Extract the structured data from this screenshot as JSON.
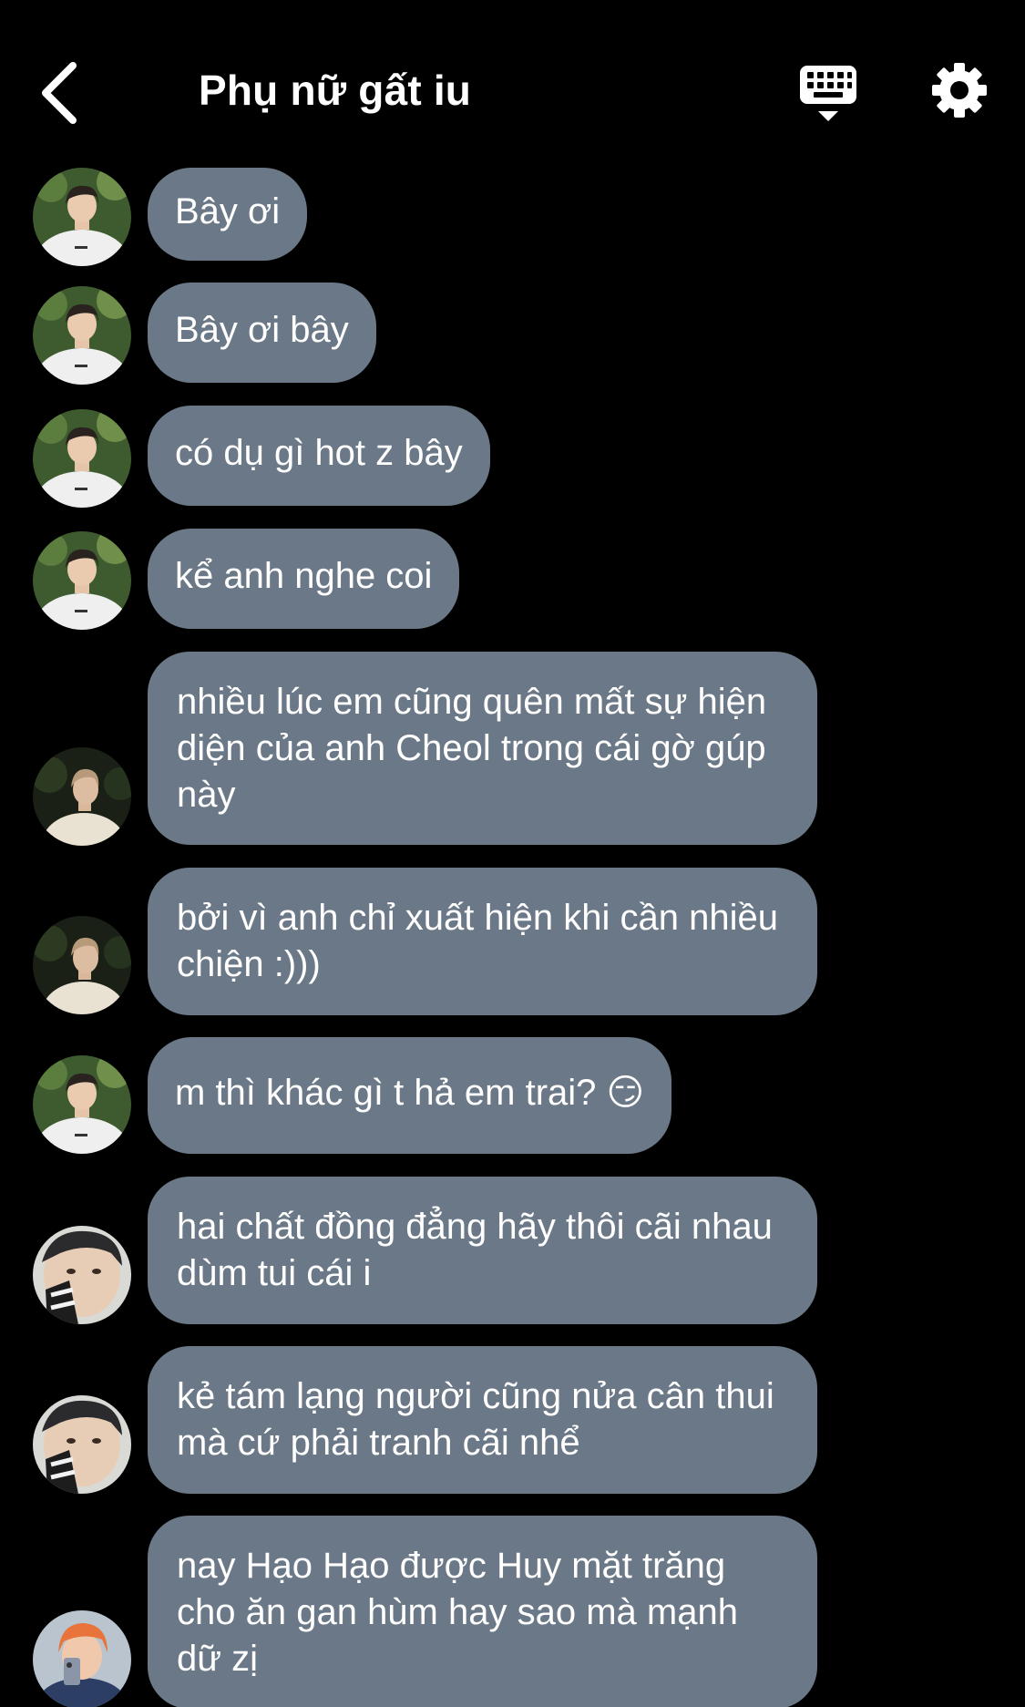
{
  "header": {
    "title": "Phụ nữ gất iu",
    "back_icon": "chevron-left-icon",
    "keyboard_icon": "keyboard-hide-icon",
    "settings_icon": "gear-icon"
  },
  "colors": {
    "background": "#000000",
    "bubble": "#6b7887",
    "text": "#ffffff"
  },
  "messages": [
    {
      "avatar": "avatar-a",
      "text": "Bây ơi"
    },
    {
      "avatar": "avatar-a",
      "text": "Bây ơi bây"
    },
    {
      "avatar": "avatar-a",
      "text": "có dụ gì hot z bây"
    },
    {
      "avatar": "avatar-a",
      "text": "kể anh nghe coi"
    },
    {
      "avatar": "avatar-b",
      "text": "nhiều lúc em cũng quên mất sự hiện diện của anh Cheol trong cái gờ gúp này"
    },
    {
      "avatar": "avatar-b",
      "text": "bởi vì anh chỉ xuất hiện khi cần nhiều chiện :)))"
    },
    {
      "avatar": "avatar-a",
      "text": "m thì khác gì t hả em trai? 😏"
    },
    {
      "avatar": "avatar-c",
      "text": "hai chất đồng đẳng hãy thôi cãi nhau dùm tui cái i"
    },
    {
      "avatar": "avatar-c",
      "text": "kẻ tám lạng người cũng nửa cân thui mà cứ phải tranh cãi nhể"
    },
    {
      "avatar": "avatar-d",
      "text": "nay Hạo Hạo được Huy mặt trăng cho ăn gan hùm hay sao mà mạnh dữ zị"
    }
  ]
}
